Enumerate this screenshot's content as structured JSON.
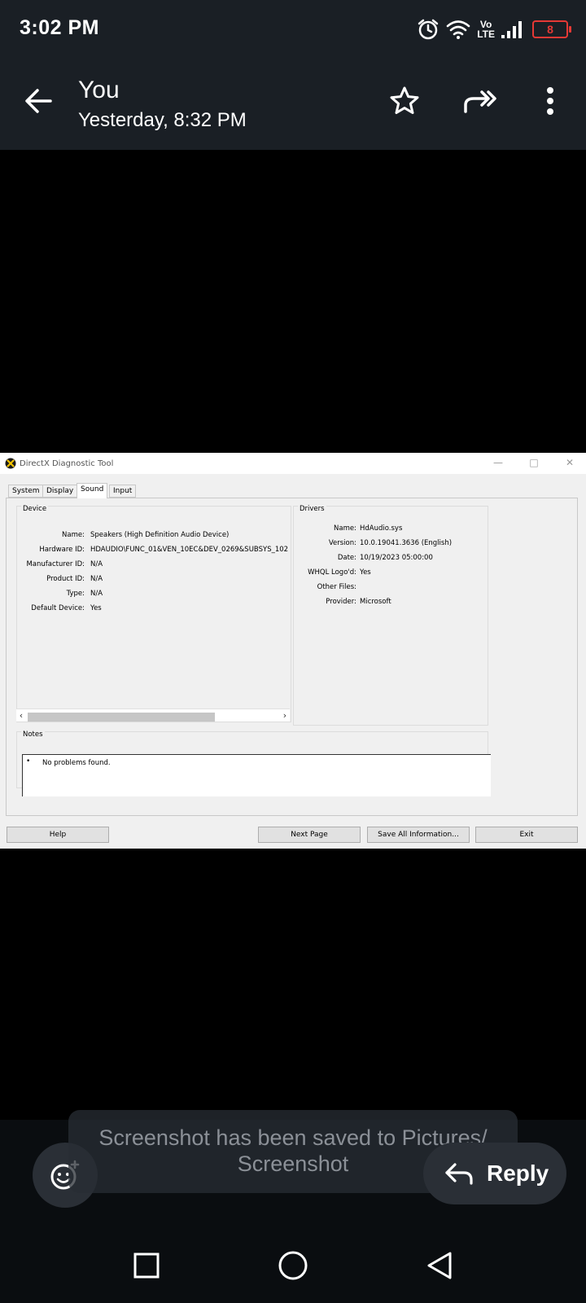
{
  "status_bar": {
    "time": "3:02 PM",
    "volte_top": "Vo",
    "volte_bottom": "LTE",
    "battery": "8",
    "icons": [
      "alarm-icon",
      "wifi-icon",
      "signal-icon",
      "battery-icon"
    ]
  },
  "header": {
    "sender": "You",
    "timestamp": "Yesterday, 8:32 PM",
    "icons": [
      "back-arrow-icon",
      "star-icon",
      "forward-icon",
      "more-vert-icon"
    ]
  },
  "dxdiag": {
    "title": "DirectX Diagnostic Tool",
    "tabs": [
      "System",
      "Display",
      "Sound",
      "Input"
    ],
    "active_tab": "Sound",
    "device": {
      "group_label": "Device",
      "rows": [
        {
          "label": "Name:",
          "value": "Speakers (High Definition Audio Device)"
        },
        {
          "label": "Hardware ID:",
          "value": "HDAUDIO\\FUNC_01&VEN_10EC&DEV_0269&SUBSYS_102"
        },
        {
          "label": "Manufacturer ID:",
          "value": "N/A"
        },
        {
          "label": "Product ID:",
          "value": "N/A"
        },
        {
          "label": "Type:",
          "value": "N/A"
        },
        {
          "label": "Default Device:",
          "value": "Yes"
        }
      ]
    },
    "drivers": {
      "group_label": "Drivers",
      "rows": [
        {
          "label": "Name:",
          "value": "HdAudio.sys"
        },
        {
          "label": "Version:",
          "value": "10.0.19041.3636 (English)"
        },
        {
          "label": "Date:",
          "value": "10/19/2023 05:00:00"
        },
        {
          "label": "WHQL Logo'd:",
          "value": "Yes"
        },
        {
          "label": "Other Files:",
          "value": ""
        },
        {
          "label": "Provider:",
          "value": "Microsoft"
        }
      ]
    },
    "notes": {
      "group_label": "Notes",
      "bullet": "•",
      "text": "No problems found."
    },
    "buttons": {
      "help": "Help",
      "next_page": "Next Page",
      "save_all": "Save All Information...",
      "exit": "Exit"
    }
  },
  "toast": {
    "line1": "Screenshot has been saved to  Pictures/",
    "line2": "Screenshot"
  },
  "actions": {
    "reply": "Reply"
  },
  "nav": {
    "icons": [
      "recents-square-icon",
      "home-circle-icon",
      "back-triangle-icon"
    ]
  }
}
